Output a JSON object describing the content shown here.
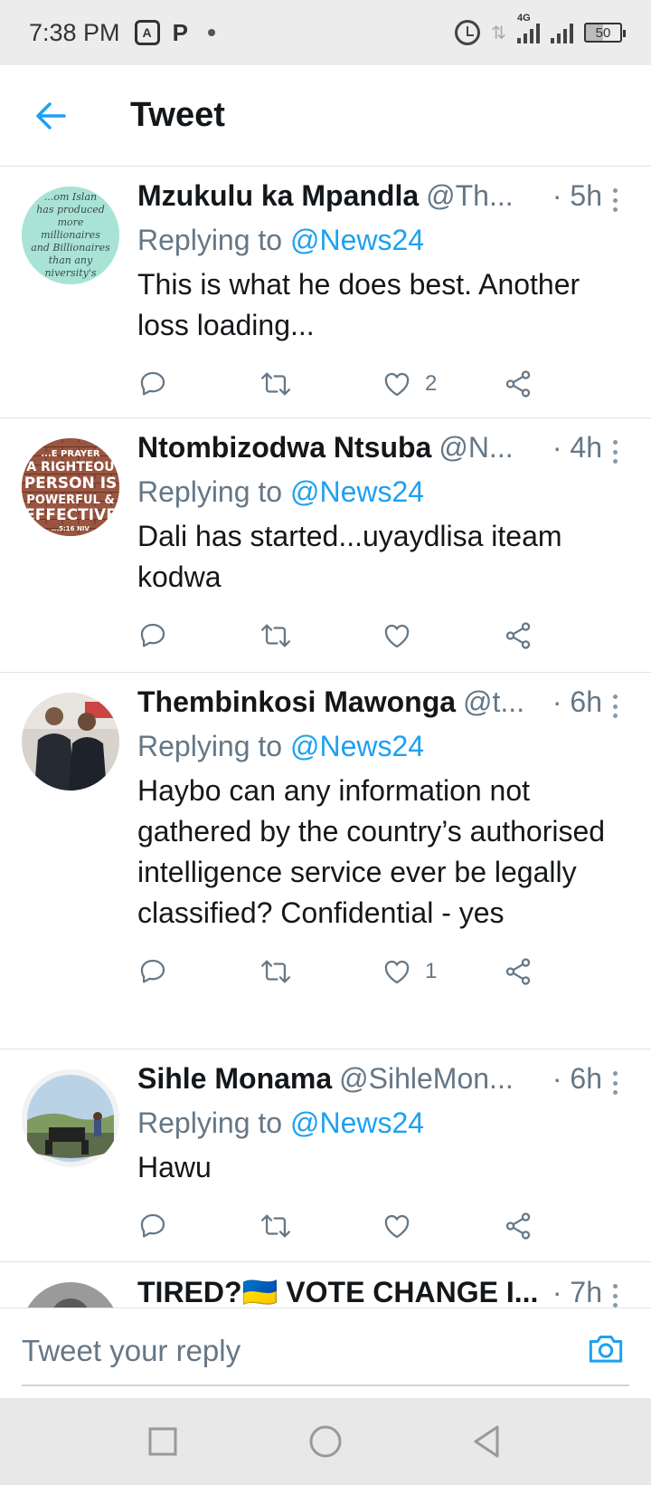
{
  "status_bar": {
    "time": "7:38 PM",
    "box_icon_label": "A",
    "p_icon_label": "P",
    "network_label": "4G",
    "battery": "50"
  },
  "header": {
    "title": "Tweet"
  },
  "tweets": [
    {
      "name": "Mzukulu ka Mpandla",
      "handle": "@Th...",
      "time": "· 5h",
      "reply_prefix": "Replying to ",
      "reply_to": "@News24",
      "text": "This is what he does best. Another loss loading...",
      "likes": "2"
    },
    {
      "name": "Ntombizodwa Ntsuba",
      "handle": "@N...",
      "time": "· 4h",
      "reply_prefix": "Replying to ",
      "reply_to": "@News24",
      "text": "Dali has started...uyaydlisa iteam kodwa",
      "likes": ""
    },
    {
      "name": "Thembinkosi Mawonga",
      "handle": "@t...",
      "time": "· 6h",
      "reply_prefix": "Replying to ",
      "reply_to": "@News24",
      "text": "Haybo can any information not gathered by the country’s authorised intelligence service ever be legally classified? Confidential - yes",
      "likes": "1"
    },
    {
      "name": "Sihle Monama",
      "handle": "@SihleMon...",
      "time": "· 6h",
      "reply_prefix": "Replying to ",
      "reply_to": "@News24",
      "text": "Hawu",
      "likes": ""
    },
    {
      "name": "TIRED?🇺🇦 VOTE CHANGE I...",
      "handle": "",
      "time": "· 7h",
      "reply_prefix": "",
      "reply_to": "",
      "text": "",
      "likes": ""
    }
  ],
  "avatar_text": {
    "tweet1": "...om Islan has produced more millionaires and Billionaires than any niversity's",
    "tweet2": "...E PRAYER A RIGHTEOU PERSON IS POWERFUL & EFFECTIVE ...5:16 NIV"
  },
  "reply_bar": {
    "placeholder": "Tweet your reply"
  },
  "colors": {
    "accent": "#1da1f2",
    "secondary_text": "#657786",
    "divider": "#dfe3e6"
  }
}
